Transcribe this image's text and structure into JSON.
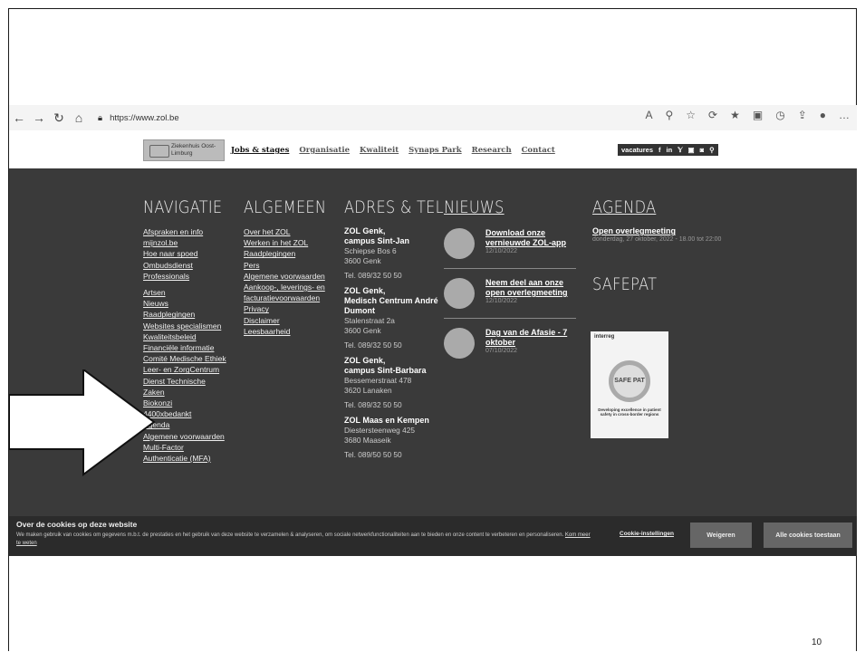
{
  "browser": {
    "url": "https://www.zol.be"
  },
  "header": {
    "logo_text": "Ziekenhuis Oost-Limburg",
    "nav": [
      "Jobs & stages",
      "Organisatie",
      "Kwaliteit",
      "Synaps Park",
      "Research",
      "Contact"
    ],
    "vacatures_label": "vacatures",
    "social": [
      "f",
      "in",
      "𝕐",
      "▣",
      "◙"
    ]
  },
  "footer": {
    "nav_title": "NAVIGATIE",
    "nav_links_1": [
      "Afspraken en info",
      "mijnzol.be",
      "Hoe naar spoed",
      "Ombudsdienst",
      "Professionals"
    ],
    "nav_links_2": [
      "Artsen",
      "Nieuws",
      "Raadplegingen",
      "Websites specialismen",
      "Kwaliteitsbeleid",
      "Financiële informatie",
      "Comité Medische Ethiek",
      "Leer- en ZorgCentrum",
      "Dienst Technische",
      "Zaken",
      "Biokonzi",
      "4400xbedankt",
      "Agenda",
      "Algemene voorwaarden",
      "Multi-Factor",
      "Authenticatie (MFA)"
    ],
    "general_title": "ALGEMEEN",
    "general_links": [
      "Over het ZOL",
      "Werken in het ZOL",
      "Raadplegingen",
      "Pers",
      "Algemene voorwaarden",
      "Aankoop-, leverings- en",
      "facturatievoorwaarden",
      "Privacy",
      "Disclaimer",
      "Leesbaarheid"
    ],
    "address_title": "ADRES & TEL.",
    "addresses": [
      {
        "name1": "ZOL Genk,",
        "name2": "campus Sint-Jan",
        "street": "Schiepse Bos 6",
        "city": "3600 Genk",
        "tel": "Tel. 089/32 50 50"
      },
      {
        "name1": "ZOL Genk,",
        "name2": "Medisch Centrum André Dumont",
        "street": "Stalenstraat 2a",
        "city": "3600 Genk",
        "tel": "Tel. 089/32 50 50"
      },
      {
        "name1": "ZOL Genk,",
        "name2": "campus Sint-Barbara",
        "street": "Bessemerstraat 478",
        "city": "3620 Lanaken",
        "tel": "Tel. 089/32 50 50"
      },
      {
        "name1": "ZOL Maas en Kempen",
        "name2": "",
        "street": "Diestersteenweg 425",
        "city": "3680 Maaseik",
        "tel": "Tel. 089/50 50 50"
      }
    ],
    "news_title": "NIEUWS",
    "news": [
      {
        "title": "Download onze vernieuwde ZOL-app",
        "date": "12/10/2022"
      },
      {
        "title": "Neem deel aan onze open overlegmeeting",
        "date": "12/10/2022"
      },
      {
        "title": "Dag van de Afasie - 7 oktober",
        "date": "07/10/2022"
      }
    ],
    "agenda_title": "AGENDA",
    "agenda_event": "Open overlegmeeting",
    "agenda_date": "donderdag, 27 oktober, 2022 - 18.00 tot 22:00",
    "safepat_title": "SAFEPAT",
    "poster_top": "interreg",
    "poster_center": "SAFE PAT",
    "poster_caption": "Developing excellence in patient safety in cross-border regions"
  },
  "cookie": {
    "title": "Over de cookies op deze website",
    "text": "We maken gebruik van cookies om gegevens m.b.t. de prestaties en het gebruik van deze website te verzamelen & analyseren, om sociale netwerkfunctionaliteiten aan te bieden en onze content te verbeteren en personaliseren.",
    "more": "Kom meer te weten",
    "settings": "Cookie-instellingen",
    "reject": "Weigeren",
    "accept": "Alle cookies toestaan"
  },
  "slide": {
    "page_number": "10"
  }
}
